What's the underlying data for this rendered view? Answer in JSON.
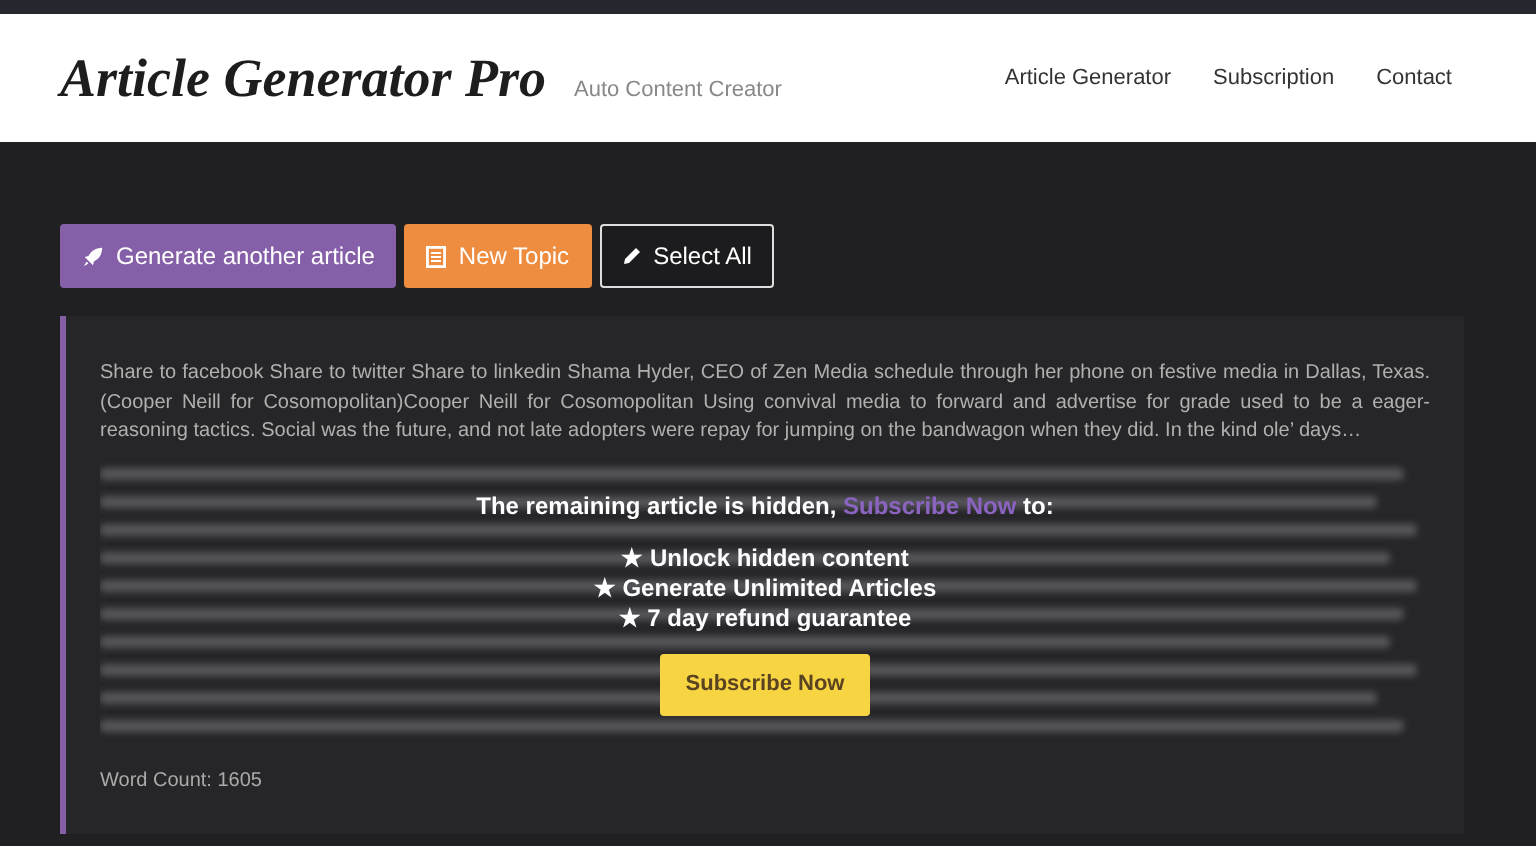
{
  "header": {
    "logo": "Article Generator Pro",
    "tagline": "Auto Content Creator",
    "nav": [
      {
        "label": "Article Generator"
      },
      {
        "label": "Subscription"
      },
      {
        "label": "Contact"
      }
    ]
  },
  "toolbar": [
    {
      "kind": "generate",
      "label": "Generate another article"
    },
    {
      "kind": "topic",
      "label": "New Topic"
    },
    {
      "kind": "select",
      "label": "Select All"
    }
  ],
  "article": {
    "text": "Share to facebook Share to twitter Share to linkedin Shama Hyder, CEO of Zen Media schedule through her phone on festive media in Dallas, Texas. (Cooper Neill for Cosomopolitan)Cooper Neill for Cosomopolitan Using convival media to forward and advertise for grade used to be a eager-reasoning tactics. Social was the future, and not late adopters were repay for jumping on the bandwagon when they did. In the kind ole’ days…",
    "paywall": {
      "message_start": "The remaining article is hidden,",
      "link": "Subscribe Now",
      "message_end": "to:",
      "benefits": [
        "★ Unlock hidden content",
        "★ Generate Unlimited Articles",
        "★ 7 day refund guarantee"
      ],
      "button": "Subscribe Now"
    },
    "word_count": "Word Count: 1605"
  }
}
